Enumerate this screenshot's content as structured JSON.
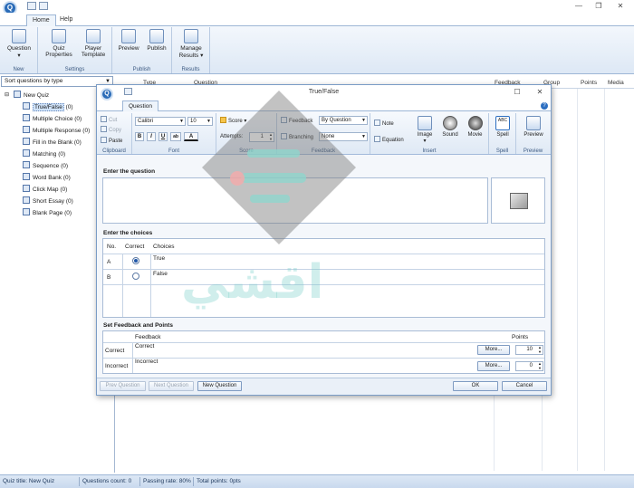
{
  "app": {
    "logo_letter": "Q",
    "window_controls": {
      "minimize": "—",
      "restore": "❐",
      "close": "✕"
    }
  },
  "main_tabs": [
    "Home",
    "Help"
  ],
  "ribbon": {
    "groups": [
      {
        "label": "New",
        "buttons": [
          {
            "label": "Question",
            "has_menu": true,
            "icon": "question-icon"
          }
        ]
      },
      {
        "label": "Settings",
        "buttons": [
          {
            "label": "Quiz Properties",
            "icon": "quiz-properties-icon"
          },
          {
            "label": "Player Template",
            "icon": "player-template-icon"
          }
        ]
      },
      {
        "label": "Publish",
        "buttons": [
          {
            "label": "Preview",
            "icon": "preview-icon"
          },
          {
            "label": "Publish",
            "icon": "publish-icon"
          }
        ]
      },
      {
        "label": "Results",
        "buttons": [
          {
            "label": "Manage Results",
            "has_menu": true,
            "icon": "manage-results-icon"
          }
        ]
      }
    ]
  },
  "sort_select": {
    "value": "Sort questions by type"
  },
  "tree": {
    "root": {
      "label": "New Quiz",
      "toggle": "⊟"
    },
    "items": [
      {
        "label": "True/False",
        "count": "(0)",
        "selected": true
      },
      {
        "label": "Multiple Choice",
        "count": "(0)"
      },
      {
        "label": "Multiple Response",
        "count": "(0)"
      },
      {
        "label": "Fill in the Blank",
        "count": "(0)"
      },
      {
        "label": "Matching",
        "count": "(0)"
      },
      {
        "label": "Sequence",
        "count": "(0)"
      },
      {
        "label": "Word Bank",
        "count": "(0)"
      },
      {
        "label": "Click Map",
        "count": "(0)"
      },
      {
        "label": "Short Essay",
        "count": "(0)"
      },
      {
        "label": "Blank Page",
        "count": "(0)"
      }
    ]
  },
  "list_columns": [
    "Type",
    "Question",
    "Feedback",
    "Group",
    "Points",
    "Media"
  ],
  "status": {
    "quiz_title": "Quiz title: New Quiz",
    "questions_count": "Questions count: 0",
    "passing_rate": "Passing rate: 80%",
    "total_points": "Total points: 0pts"
  },
  "dialog": {
    "title": "True/False",
    "tab": "Question",
    "help": "?",
    "ribbon": {
      "clipboard": {
        "label": "Clipboard",
        "cut": "Cut",
        "copy": "Copy",
        "paste": "Paste"
      },
      "font": {
        "label": "Font",
        "family": "Calibri",
        "size": "10",
        "bold": "B",
        "italic": "I",
        "underline": "U",
        "ab": "ab",
        "color": "A"
      },
      "score": {
        "label": "Score",
        "score_btn": "Score",
        "attempts_label": "Attempts:",
        "attempts_value": "1"
      },
      "feedback": {
        "label": "Feedback",
        "feedback_btn": "Feedback",
        "feedback_value": "By Question",
        "branching_btn": "Branching",
        "branching_value": "None"
      },
      "insert": {
        "label": "Insert",
        "note": "Note",
        "equation": "Equation",
        "image": "Image",
        "sound": "Sound",
        "movie": "Movie"
      },
      "spell": {
        "label": "Spell",
        "button": "Spell",
        "abc": "ABC"
      },
      "preview": {
        "label": "Preview",
        "button": "Preview"
      }
    },
    "question_section": "Enter the question",
    "choices_section": "Enter the choices",
    "choices_headers": {
      "no": "No.",
      "correct": "Correct",
      "choices": "Choices"
    },
    "choices": [
      {
        "no": "A",
        "correct": true,
        "text": "True"
      },
      {
        "no": "B",
        "correct": false,
        "text": "False"
      }
    ],
    "feedback_section": "Set Feedback and Points",
    "feedback_headers": {
      "feedback": "Feedback",
      "points": "Points"
    },
    "feedback_rows": [
      {
        "label": "Correct",
        "text": "Correct",
        "more": "More...",
        "points": "10"
      },
      {
        "label": "Incorrect",
        "text": "Incorrect",
        "more": "More...",
        "points": "0"
      }
    ],
    "buttons": {
      "prev": "Prev Question",
      "next": "Next Question",
      "new": "New Question",
      "ok": "OK",
      "cancel": "Cancel"
    }
  },
  "watermark": {
    "text": "اقشي"
  }
}
